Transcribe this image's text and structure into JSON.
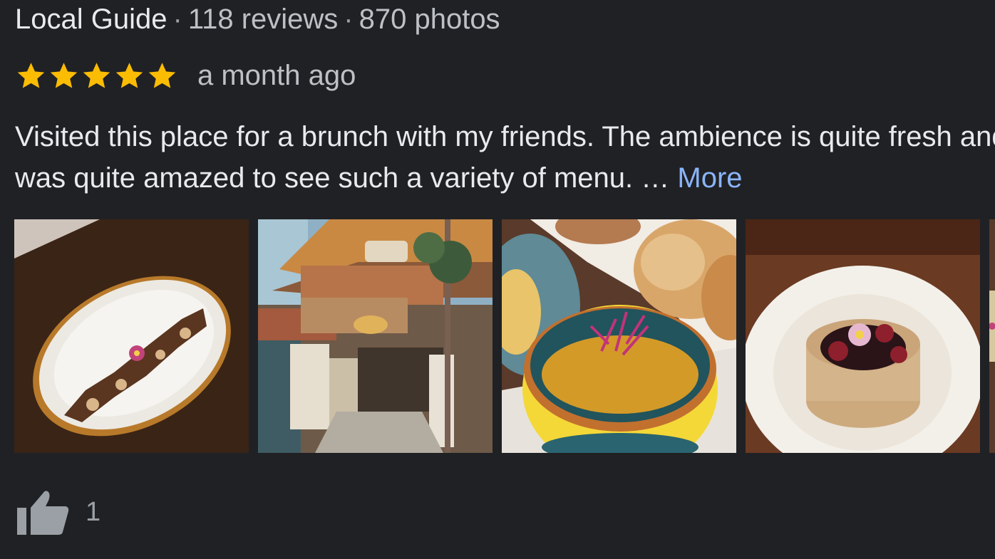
{
  "reviewer": {
    "badge": "Local Guide",
    "separator": "·",
    "reviews_count": "118 reviews",
    "photos_count": "870 photos"
  },
  "rating": {
    "stars": 5,
    "max_stars": 5,
    "star_color": "#fbbc04",
    "time_ago": "a month ago"
  },
  "review": {
    "line1": "Visited this place for a brunch with my friends. The ambience is quite fresh and I",
    "line2": "was quite amazed to see such a variety of menu. …",
    "more_label": "More"
  },
  "photos": [
    {
      "name": "photo-dessert-plate"
    },
    {
      "name": "photo-restaurant-entrance"
    },
    {
      "name": "photo-curry-bowl"
    },
    {
      "name": "photo-quinoa-dish"
    },
    {
      "name": "photo-partial"
    }
  ],
  "likes": {
    "icon": "thumbs-up-icon",
    "count": "1"
  }
}
